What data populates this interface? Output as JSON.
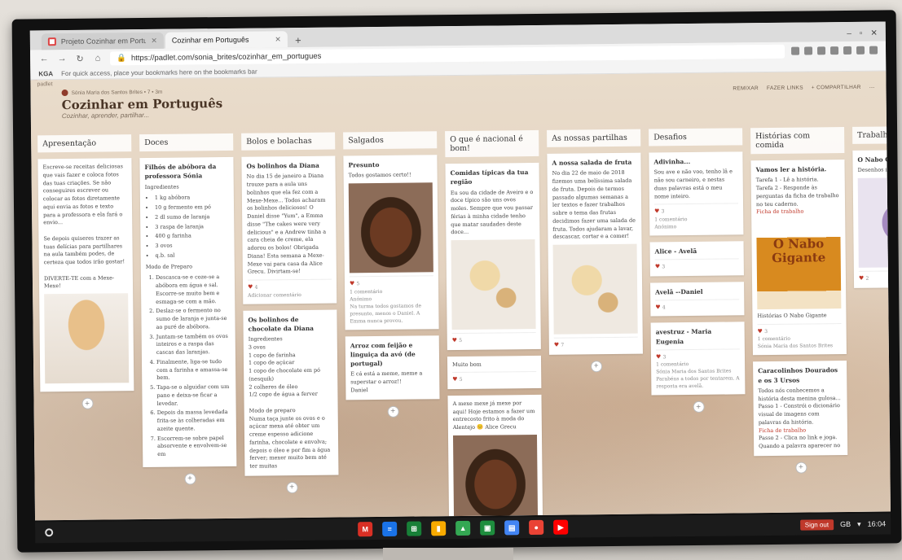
{
  "browser": {
    "tabs": [
      {
        "label": "Projeto Cozinhar em Português",
        "active": false,
        "icon": "gmail-icon"
      },
      {
        "label": "Cozinhar em Português",
        "active": true,
        "icon": "padlet-icon"
      }
    ],
    "new_tab": "+",
    "url": "https://padlet.com/sonia_brites/cozinhar_em_portugues",
    "bookmarks": {
      "apps": "KGA",
      "hint": "For quick access, place your bookmarks here on the bookmarks bar"
    }
  },
  "padlet": {
    "brand": "padlet",
    "author": "Sónia Maria dos Santos Brites  •  7  •  3m",
    "title": "Cozinhar em Português",
    "subtitle": "Cozinhar, aprender, partilhar...",
    "actions": [
      "REMIXAR",
      "FAZER LINKS",
      "+ COMPARTILHAR"
    ],
    "columns": [
      {
        "title": "Apresentação",
        "cards": [
          {
            "body": "Escreve-se receitas deliciosas que vais fazer e coloca fotos das tuas criações. Se não conseguires escrever ou colocar as fotos diretamente aqui envia as fotos e texto para a professora e ela fará o envio...\n\nSe depois quiseres trazer as tuas delícias para partilhares na aula também podes, de certeza que todos irão gostar!\n\nDIVERTE-TE com a Mexe-Mexe!",
            "photo": "spoon"
          }
        ]
      },
      {
        "title": "Doces",
        "cards": [
          {
            "heading": "Filhós de abóbora da professora Sónia",
            "sub": "Ingredientes",
            "list": [
              "1 kg abóbora",
              "10 g fermento em pó",
              "2 dl sumo de laranja",
              "3 raspa de laranja",
              "400 g farinha",
              "3 ovos",
              "q.b. sal"
            ],
            "sub2": "Modo de Preparo",
            "steps": [
              "Descasca-se e coze-se a abóbora em água e sal. Escorre-se muito bem e esmaga-se com a mão.",
              "Deslaz-se o fermento no sumo de laranja e junta-se ao puré de abóbora.",
              "Juntam-se também os ovos inteiros e a raspa das cascas das laranjas.",
              "Finalmente, liga-se tudo com a farinha e amassa-se bem.",
              "Tapa-se o alguidar com um pano e deixa-se ficar a levedar.",
              "Depois da massa levedada frita-se às colheradas em azeite quente.",
              "Escorrem-se sobre papel absorvente e envolvem-se em"
            ]
          }
        ]
      },
      {
        "title": "Bolos e bolachas",
        "cards": [
          {
            "heading": "Os bolinhos da Diana",
            "body": "No dia 15 de janeiro a Diana trouxe para a aula uns bolinhos que ela fez com a Mexe-Mexe... Todos acharam os bolinhos deliciosos! O Daniel disse \"Yum\", a Emma disse \"The cakes were very delicious\" e a Andrew tinha a cara cheia de creme, ela adorou os bolos! Obrigada Diana! Esta semana a Mexe-Mexe vai para casa da Alice Grecu. Divirtam-se!",
            "hearts": "4",
            "comment": "Adicionar comentário"
          },
          {
            "heading": "Os bolinhos de chocolate da Diana",
            "sub": "Ingredientes",
            "body": "3 ovos\n1 copo de farinha\n1 copo de açúcar\n1 copo de chocolate em pó (nesquik)\n2 colheres de óleo\n1/2 copo de água a ferver\n\nModo de preparo\nNuma taça junte os ovos e o açúcar mexa até obter um creme espesso adicione farinha, chocolate e envolva; depois o óleo e por fim a água ferver; mexer muito bem até ter muitas"
          }
        ]
      },
      {
        "title": "Salgados",
        "cards": [
          {
            "heading": "Presunto",
            "body": "Todos gostamos certo!!",
            "photo": "meat",
            "hearts": "5",
            "comments": "1 comentário",
            "commenter": "Anónimo",
            "comment_text": "Na turma todos gostamos de presunto, menos o Daniel. A Emma nunca provou."
          },
          {
            "heading": "Arroz com feijão e linguiça da avó          (de portugal)",
            "body": "E cá está a meme, meme a superstar o arroz!!\nDaniel"
          }
        ]
      },
      {
        "title": "O que é nacional é bom!",
        "cards": [
          {
            "heading": "Comidas típicas da tua região",
            "body": "Eu sou da cidade de Aveiro e o doce típico são uns ovos moles. Sempre que vou passar férias à minha cidade tenho que matar saudades deste doce...",
            "photo": "dishes",
            "hearts": "5"
          },
          {
            "heading": "",
            "body": "Muito bom",
            "hearts": "5"
          },
          {
            "heading": "",
            "body": "A mexe mexe já mexe por aqui! Hoje estamos a fazer um entrecosto frito à moda do Alentejo 😊 Alice Grecu",
            "photo": "meat"
          }
        ]
      },
      {
        "title": "As nossas partilhas",
        "cards": [
          {
            "heading": "A nossa salada de fruta",
            "body": "No dia 22 de maio de 2018 fizemos uma belíssima salada de fruta. Depois de termos passado algumas semanas a ler textos e fazer trabalhos sobre o tema das frutas decidimos fazer uma salada de fruta. Todos ajudaram a lavar, descascar, cortar e a comer!",
            "photo": "dishes",
            "hearts": "7"
          }
        ]
      },
      {
        "title": "Desafios",
        "cards": [
          {
            "heading": "Adivinha...",
            "body": "Sou ave e não voo, tenho lã e não sou carneiro, e nestas duas palavras está o meu nome inteiro.",
            "hearts": "3",
            "comments": "1 comentário",
            "commenter": "Anónimo"
          },
          {
            "heading": "Alice - Avelã",
            "hearts": "3"
          },
          {
            "heading": "Avelã --Daniel",
            "hearts": "4"
          },
          {
            "heading": "avestruz - Maria Eugenia",
            "hearts": "3",
            "comments": "1 comentário",
            "commenter": "Sónia Maria dos Santos Brites",
            "comment_text": "Parabéns a todos por tentarem. A resposta era avelã."
          }
        ]
      },
      {
        "title": "Histórias com comida",
        "cards": [
          {
            "heading": "Vamos ler a história.",
            "body": "Tarefa 1 - Lê a história.\nTarefa 2 - Responde às perguntas da ficha de trabalho no teu caderno.",
            "link": "Ficha de trabalho",
            "photo": "book",
            "book_title": "O Nabo Gigante",
            "caption": "Histórias O Nabo Gigante",
            "hearts": "3",
            "comments": "1 comentário",
            "commenter": "Sónia Maria dos Santos Brites"
          },
          {
            "heading": "Caracolinhos Dourados e os 3 Ursos",
            "body": "Todos nós conhecemos a história desta menina gulosa...\nPasso 1 - Constrói o dicionário visual de imagens com palavras da história.",
            "link": "Ficha de trabalho",
            "body2": "Passo 2 - Clica no link e joga. Quando a palavra aparecer no"
          }
        ]
      },
      {
        "title": "Trabalhos insp",
        "cards": [
          {
            "heading": "O Nabo Gigante",
            "body": "Desenhos inspirados",
            "photo": "blue",
            "hearts": "2"
          }
        ]
      }
    ],
    "add": "+"
  },
  "shelf": {
    "apps": [
      {
        "name": "gmail-icon",
        "color": "#d93025",
        "glyph": "M"
      },
      {
        "name": "docs-icon",
        "color": "#1a73e8",
        "glyph": "≡"
      },
      {
        "name": "sheets-icon",
        "color": "#188038",
        "glyph": "⊞"
      },
      {
        "name": "keep-icon",
        "color": "#f9ab00",
        "glyph": "▮"
      },
      {
        "name": "drive-icon",
        "color": "#34a853",
        "glyph": "▲"
      },
      {
        "name": "classroom-icon",
        "color": "#1e8e3e",
        "glyph": "▣"
      },
      {
        "name": "files-icon",
        "color": "#4285f4",
        "glyph": "▤"
      },
      {
        "name": "chrome-icon",
        "color": "#ea4335",
        "glyph": "●"
      },
      {
        "name": "youtube-icon",
        "color": "#ff0000",
        "glyph": "▶"
      }
    ],
    "signout": "Sign out",
    "region": "GB",
    "time": "16:04"
  }
}
